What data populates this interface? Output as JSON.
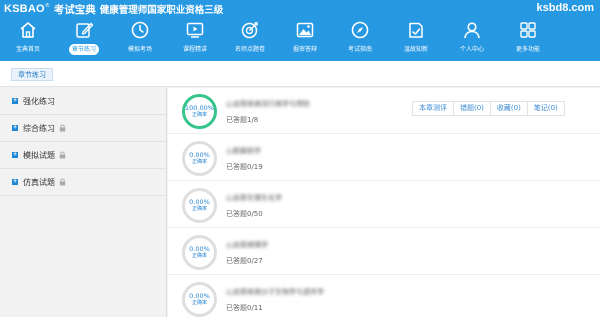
{
  "header": {
    "brand_logo": "KSBAO",
    "brand_reg": "®",
    "brand_name": "考试宝典",
    "exam_title": "健康管理师国家职业资格三级",
    "site_url": "ksbd8.com",
    "bg_color": "#2799e3"
  },
  "nav": {
    "items": [
      {
        "label": "宝典首页",
        "icon": "home-icon"
      },
      {
        "label": "章节练习",
        "icon": "edit-icon",
        "active": true
      },
      {
        "label": "模拟考场",
        "icon": "clock-icon"
      },
      {
        "label": "课程精讲",
        "icon": "video-play-icon"
      },
      {
        "label": "名师点题卷",
        "icon": "target-icon"
      },
      {
        "label": "掘审答辩",
        "icon": "mountain-icon"
      },
      {
        "label": "考试指南",
        "icon": "compass-icon"
      },
      {
        "label": "温故知新",
        "icon": "book-icon"
      },
      {
        "label": "个人中心",
        "icon": "user-icon"
      },
      {
        "label": "更多功能",
        "icon": "grid-icon"
      }
    ]
  },
  "breadcrumb": {
    "current": "章节练习"
  },
  "sidebar": {
    "items": [
      {
        "label": "强化练习",
        "locked": false
      },
      {
        "label": "综合练习",
        "locked": true
      },
      {
        "label": "模拟试题",
        "locked": true
      },
      {
        "label": "仿真试题",
        "locked": true
      }
    ]
  },
  "chapters": [
    {
      "percent": "100.00%",
      "rate_label": "正确率",
      "title": "心血管疾病流行病学与预防",
      "answered": "已答题1/8",
      "done": true
    },
    {
      "percent": "0.00%",
      "rate_label": "正确率",
      "title": "心脏解剖学",
      "answered": "已答题0/19",
      "done": false
    },
    {
      "percent": "0.00%",
      "rate_label": "正确率",
      "title": "心血管生理生化学",
      "answered": "已答题0/50",
      "done": false
    },
    {
      "percent": "0.00%",
      "rate_label": "正确率",
      "title": "心血管病理学",
      "answered": "已答题0/27",
      "done": false
    },
    {
      "percent": "0.00%",
      "rate_label": "正确率",
      "title": "心血管疾病分子生物学与遗传学",
      "answered": "已答题0/11",
      "done": false
    }
  ],
  "row_actions": [
    {
      "label": "本章测评"
    },
    {
      "label": "错题(0)"
    },
    {
      "label": "收藏(0)"
    },
    {
      "label": "笔记(0)"
    }
  ],
  "colors": {
    "accent": "#2799e3",
    "done_ring": "#35c48a",
    "pending_ring": "#dedede",
    "link": "#3a8ad6"
  }
}
